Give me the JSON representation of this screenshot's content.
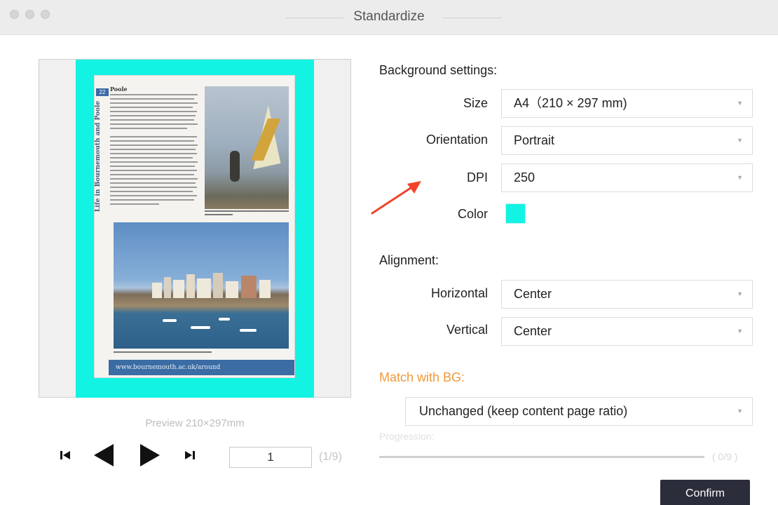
{
  "window": {
    "title": "Standardize"
  },
  "preview": {
    "label": "Preview  210×297mm",
    "document": {
      "page_number": "22",
      "side_title": "Life in Bournemouth and Poole",
      "heading": "Poole",
      "footer_text": "www.bournemouth.ac.uk/around"
    }
  },
  "navigation": {
    "current_page": "1",
    "page_count": "(1/9)"
  },
  "background_settings": {
    "title": "Background settings:",
    "size_label": "Size",
    "size_value": "A4（210 × 297 mm)",
    "orientation_label": "Orientation",
    "orientation_value": "Portrait",
    "dpi_label": "DPI",
    "dpi_value": "250",
    "color_label": "Color",
    "color_value": "#13f3e3"
  },
  "alignment": {
    "title": "Alignment:",
    "horizontal_label": "Horizontal",
    "horizontal_value": "Center",
    "vertical_label": "Vertical",
    "vertical_value": "Center"
  },
  "match": {
    "title": "Match with BG:",
    "value": "Unchanged (keep content page ratio)"
  },
  "progress": {
    "label": "Progression:",
    "count": "( 0/9 )",
    "fraction": 0
  },
  "actions": {
    "confirm_label": "Confirm"
  },
  "colors": {
    "accent_cyan": "#13f3e3",
    "match_orange": "#f09a3a",
    "confirm_bg": "#2b2d3b",
    "annotation_arrow": "#f0442a"
  }
}
